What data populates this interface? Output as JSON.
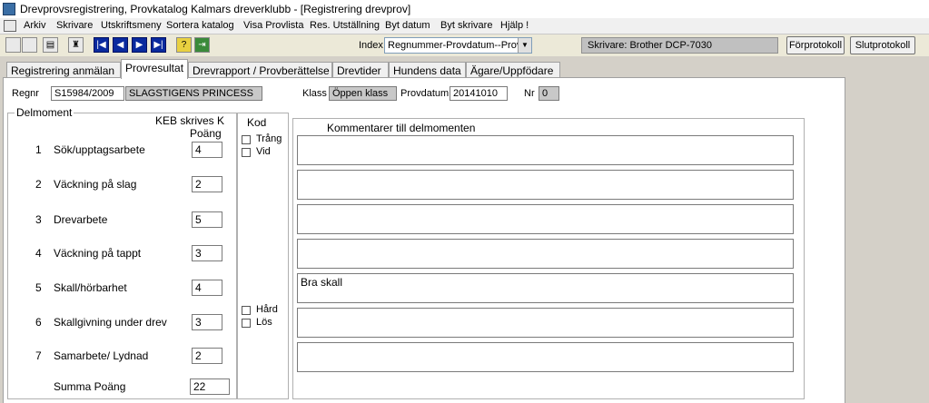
{
  "window": {
    "title": "Drevprovsregistrering, Provkatalog  Kalmars dreverklubb - [Registrering drevprov]"
  },
  "menu": [
    "Arkiv",
    "Skrivare",
    "Utskriftsmeny",
    "Sortera katalog",
    "Visa Provlista",
    "Res. Utställning",
    "Byt datum",
    "Byt skrivare",
    "Hjälp !"
  ],
  "toolbar": {
    "index_label": "Index",
    "index_value": "Regnummer-Provdatum--Provnr",
    "printer": "Skrivare: Brother DCP-7030",
    "forprotokoll": "Förprotokoll",
    "slutprotokoll": "Slutprotokoll"
  },
  "tabs": [
    "Registrering anmälan",
    "Provresultat",
    "Drevrapport / Provberättelse",
    "Drevtider",
    "Hundens data",
    "Ägare/Uppfödare"
  ],
  "header": {
    "regnr_label": "Regnr",
    "regnr": "S15984/2009",
    "name": "SLAGSTIGENS PRINCESS",
    "klass_label": "Klass",
    "klass": "Öppen klass",
    "provdatum_label": "Provdatum:",
    "provdatum": "20141010",
    "nr_label": "Nr",
    "nr": "0"
  },
  "delmoment": {
    "title": "Delmoment",
    "keb_header": "KEB skrives K",
    "poang_header": "Poäng",
    "rows": [
      {
        "num": "1",
        "label": "Sök/upptagsarbete",
        "score": "4",
        "comment": ""
      },
      {
        "num": "2",
        "label": "Väckning på slag",
        "score": "2",
        "comment": ""
      },
      {
        "num": "3",
        "label": "Drevarbete",
        "score": "5",
        "comment": ""
      },
      {
        "num": "4",
        "label": "Väckning på tappt",
        "score": "3",
        "comment": ""
      },
      {
        "num": "5",
        "label": "Skall/hörbarhet",
        "score": "4",
        "comment": "Bra skall"
      },
      {
        "num": "6",
        "label": "Skallgivning under drev",
        "score": "3",
        "comment": ""
      },
      {
        "num": "7",
        "label": "Samarbete/ Lydnad",
        "score": "2",
        "comment": ""
      }
    ],
    "sum_label": "Summa Poäng",
    "sum": "22"
  },
  "kod": {
    "title": "Kod",
    "trang": "Trång",
    "vid": "Vid",
    "hard": "Hård",
    "los": "Lös"
  },
  "comments_title": "Kommentarer till delmomenten"
}
